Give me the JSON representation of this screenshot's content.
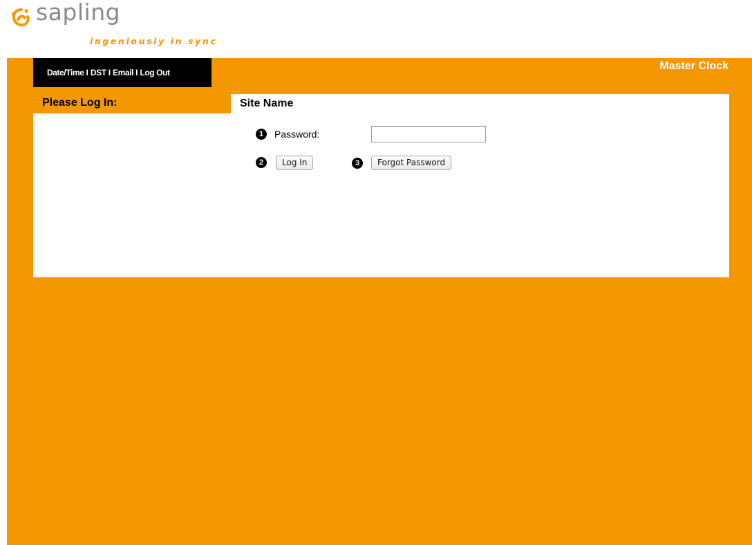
{
  "brand": {
    "name": "sapling",
    "tagline": "ingeniously in sync",
    "accent_color": "#f39800",
    "logo_icon": "sapling-swirl-icon"
  },
  "nav": {
    "items": [
      {
        "label": "Date/Time"
      },
      {
        "label": "DST"
      },
      {
        "label": "Email"
      },
      {
        "label": "Log Out"
      }
    ],
    "separator": "I"
  },
  "header": {
    "title": "Master Clock"
  },
  "sidebar": {
    "title": "Please Log In:"
  },
  "main": {
    "site_name": "Site Name",
    "markers": [
      "1",
      "2",
      "3"
    ],
    "password_label": "Password:",
    "password_value": "",
    "login_button": "Log In",
    "forgot_button": "Forgot Password"
  }
}
